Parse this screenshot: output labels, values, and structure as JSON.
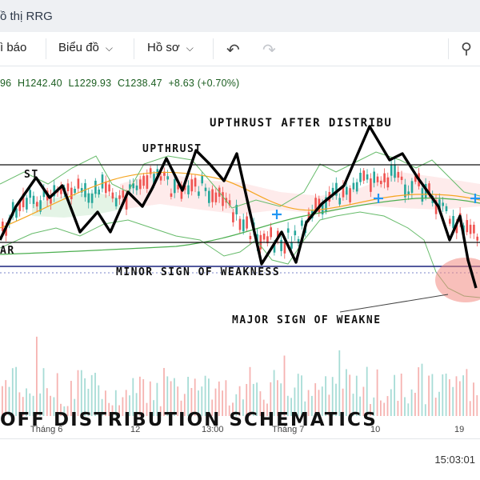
{
  "window": {
    "title": "ồ thị RRG"
  },
  "toolbar": {
    "items": [
      {
        "label": "ì báo"
      },
      {
        "label": "Biểu đồ"
      },
      {
        "label": "Hồ sơ"
      }
    ],
    "icons": [
      "undo-icon",
      "redo-icon",
      "search-settings-icon"
    ]
  },
  "ohlc": {
    "open": "96",
    "high": "H1242.40",
    "low": "L1229.93",
    "close": "C1238.47",
    "change": "+8.63 (+0.70%)"
  },
  "annotations": {
    "upthrust_after": "UPTHRUST AFTER DISTRIBU",
    "upthrust": "UPTHRUST",
    "st": "ST",
    "ar": "AR",
    "minor_sow": "MINOR SIGN OF WEAKNESS",
    "major_sow": "MAJOR SIGN OF WEAKNE",
    "schematic_title": "OFF DISTRIBUTION SCHEMATICS"
  },
  "x_axis": {
    "labels": [
      "Tháng 6",
      "12",
      "13:00",
      "Tháng 7",
      "10",
      "19"
    ]
  },
  "status": {
    "time": "15:03:01"
  },
  "colors": {
    "up_candle": "#26a69a",
    "down_candle": "#ef5350",
    "ohlc_text": "#1b5e20",
    "support_line": "#1a237e",
    "ema_orange": "#f5a623",
    "ema_green": "#4caf50"
  }
}
